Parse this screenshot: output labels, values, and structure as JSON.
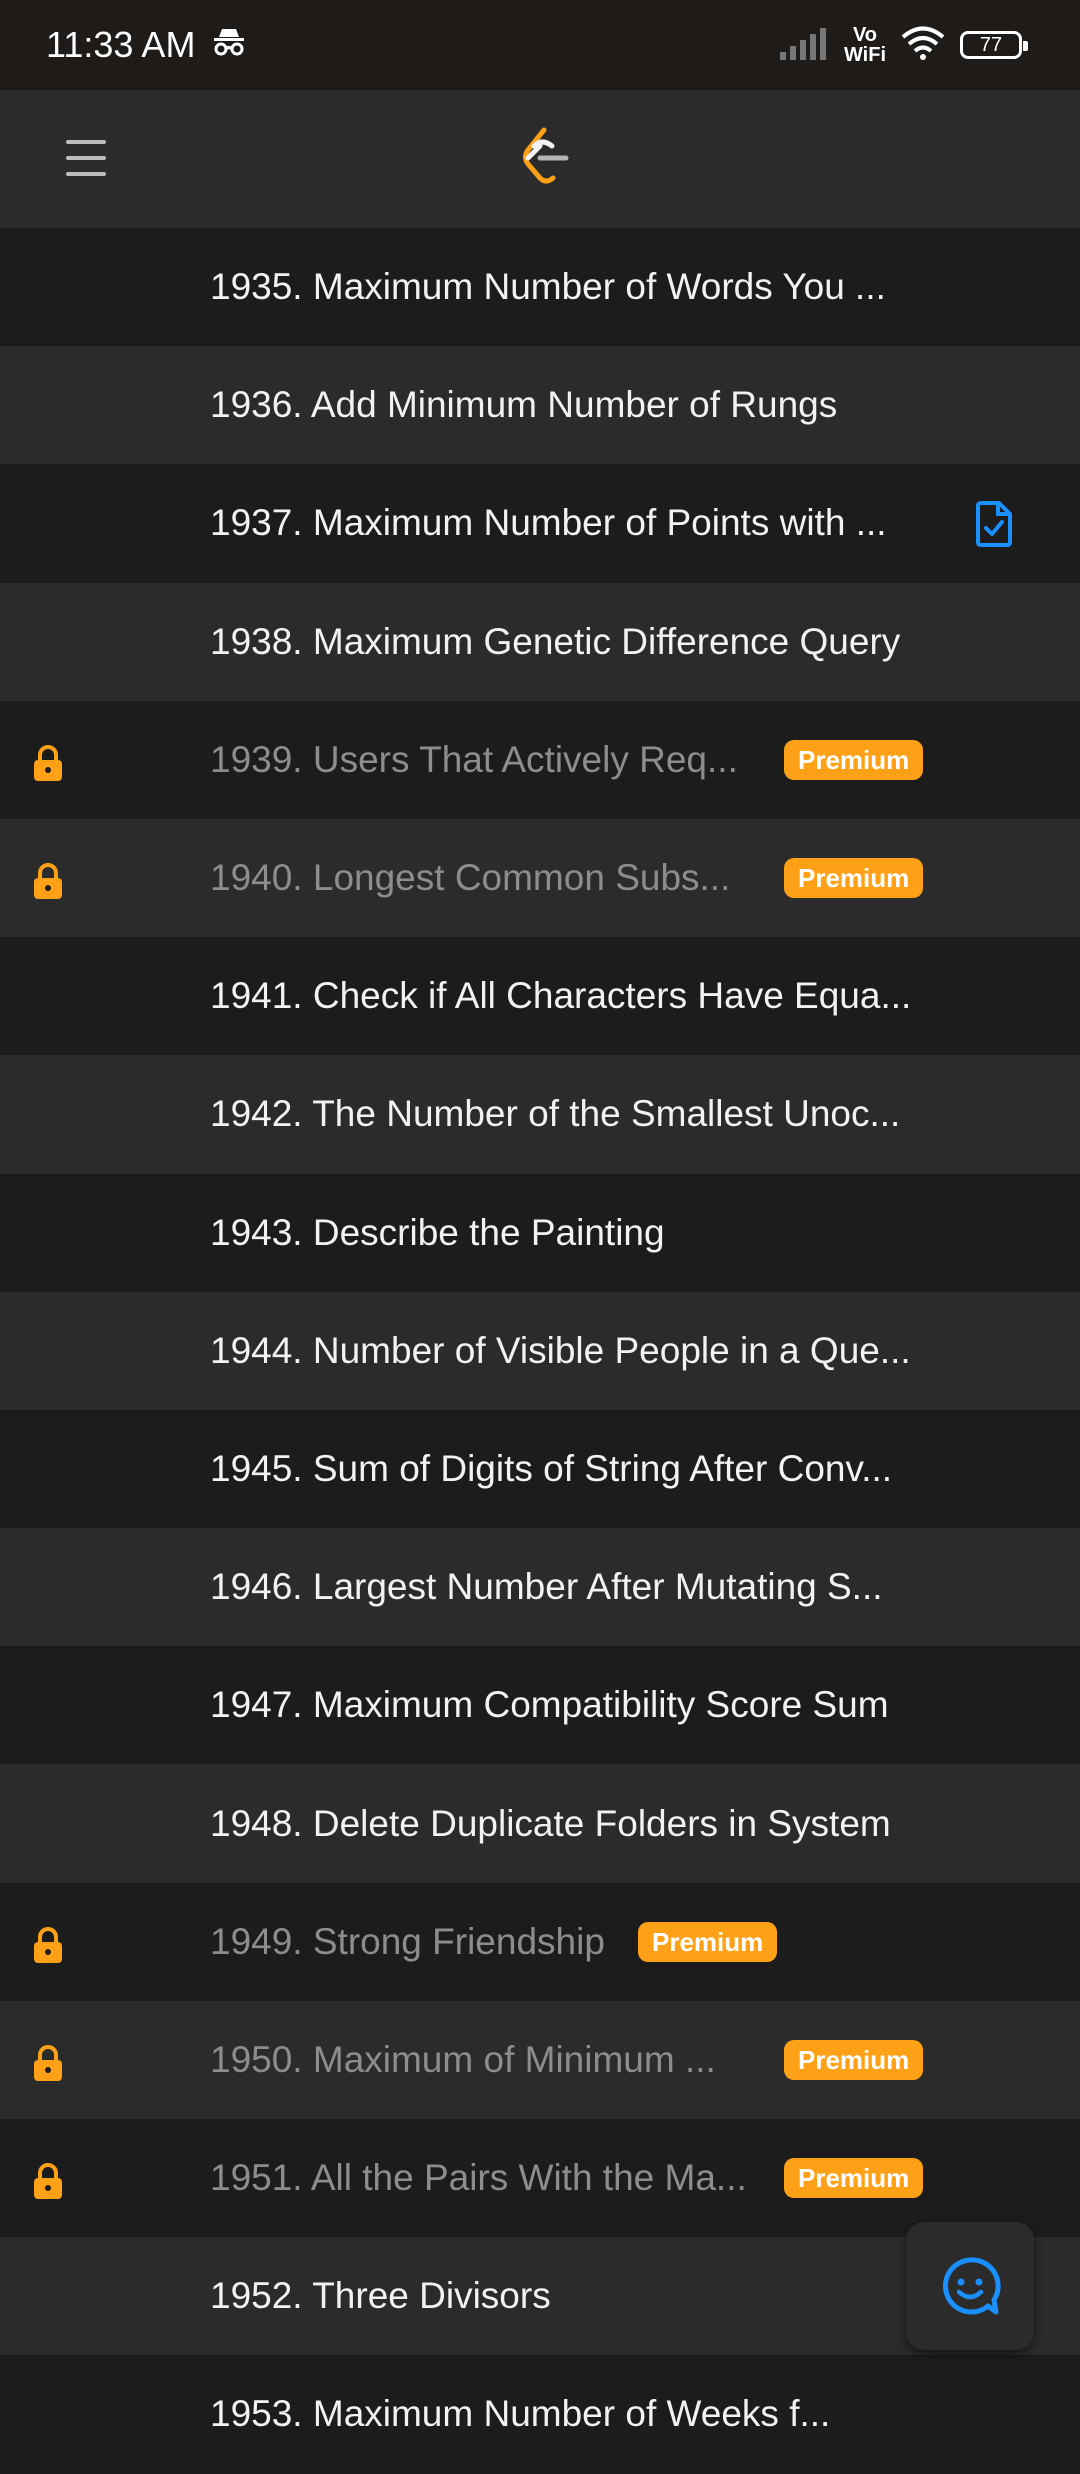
{
  "status_bar": {
    "time": "11:33 AM",
    "vowifi_top": "Vo",
    "vowifi_bottom": "WiFi",
    "battery": "77"
  },
  "colors": {
    "premium": "#ffa116",
    "solved": "#1a90ff"
  },
  "problems": [
    {
      "title": "1935. Maximum Number of Words You ...",
      "locked": false,
      "premium_label": "",
      "solved": false
    },
    {
      "title": "1936. Add Minimum Number of Rungs",
      "locked": false,
      "premium_label": "",
      "solved": false
    },
    {
      "title": "1937. Maximum Number of Points with ...",
      "locked": false,
      "premium_label": "",
      "solved": true
    },
    {
      "title": "1938. Maximum Genetic Difference Query",
      "locked": false,
      "premium_label": "",
      "solved": false
    },
    {
      "title": "1939. Users That Actively Req...",
      "locked": true,
      "premium_label": "Premium",
      "solved": false
    },
    {
      "title": "1940. Longest Common Subs...",
      "locked": true,
      "premium_label": "Premium",
      "solved": false
    },
    {
      "title": "1941. Check if All Characters Have Equa...",
      "locked": false,
      "premium_label": "",
      "solved": false
    },
    {
      "title": "1942. The Number of the Smallest Unoc...",
      "locked": false,
      "premium_label": "",
      "solved": false
    },
    {
      "title": "1943. Describe the Painting",
      "locked": false,
      "premium_label": "",
      "solved": false
    },
    {
      "title": "1944. Number of Visible People in a Que...",
      "locked": false,
      "premium_label": "",
      "solved": false
    },
    {
      "title": "1945. Sum of Digits of String After Conv...",
      "locked": false,
      "premium_label": "",
      "solved": false
    },
    {
      "title": "1946. Largest Number After Mutating S...",
      "locked": false,
      "premium_label": "",
      "solved": false
    },
    {
      "title": "1947. Maximum Compatibility Score Sum",
      "locked": false,
      "premium_label": "",
      "solved": false
    },
    {
      "title": "1948. Delete Duplicate Folders in System",
      "locked": false,
      "premium_label": "",
      "solved": false
    },
    {
      "title": "1949. Strong Friendship",
      "locked": true,
      "premium_label": "Premium",
      "solved": false
    },
    {
      "title": "1950. Maximum of Minimum ...",
      "locked": true,
      "premium_label": "Premium",
      "solved": false
    },
    {
      "title": "1951. All the Pairs With the Ma...",
      "locked": true,
      "premium_label": "Premium",
      "solved": false
    },
    {
      "title": "1952. Three Divisors",
      "locked": false,
      "premium_label": "",
      "solved": false
    },
    {
      "title": "1953. Maximum Number of Weeks f...",
      "locked": false,
      "premium_label": "",
      "solved": false
    }
  ]
}
